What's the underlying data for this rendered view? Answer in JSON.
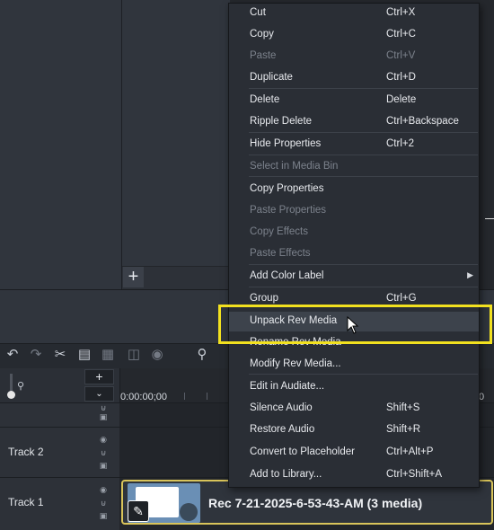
{
  "menu": {
    "items": [
      {
        "label": "Cut",
        "shortcut": "Ctrl+X",
        "disabled": false
      },
      {
        "label": "Copy",
        "shortcut": "Ctrl+C",
        "disabled": false
      },
      {
        "label": "Paste",
        "shortcut": "Ctrl+V",
        "disabled": true
      },
      {
        "label": "Duplicate",
        "shortcut": "Ctrl+D",
        "disabled": false
      },
      {
        "label": "Delete",
        "shortcut": "Delete",
        "disabled": false
      },
      {
        "label": "Ripple Delete",
        "shortcut": "Ctrl+Backspace",
        "disabled": false
      },
      {
        "label": "Hide Properties",
        "shortcut": "Ctrl+2",
        "disabled": false
      },
      {
        "label": "Select in Media Bin",
        "shortcut": "",
        "disabled": true
      },
      {
        "label": "Copy Properties",
        "shortcut": "",
        "disabled": false
      },
      {
        "label": "Paste Properties",
        "shortcut": "",
        "disabled": true
      },
      {
        "label": "Copy Effects",
        "shortcut": "",
        "disabled": true
      },
      {
        "label": "Paste Effects",
        "shortcut": "",
        "disabled": true
      },
      {
        "label": "Add Color Label",
        "shortcut": "",
        "disabled": false,
        "submenu": true
      },
      {
        "label": "Group",
        "shortcut": "Ctrl+G",
        "disabled": false
      },
      {
        "label": "Unpack Rev Media",
        "shortcut": "",
        "disabled": false,
        "highlighted": true
      },
      {
        "label": "Rename Rev Media",
        "shortcut": "",
        "disabled": false
      },
      {
        "label": "Modify Rev Media...",
        "shortcut": "",
        "disabled": false
      },
      {
        "label": "Edit in Audiate...",
        "shortcut": "",
        "disabled": false
      },
      {
        "label": "Silence Audio",
        "shortcut": "Shift+S",
        "disabled": false
      },
      {
        "label": "Restore Audio",
        "shortcut": "Shift+R",
        "disabled": false
      },
      {
        "label": "Convert to Placeholder",
        "shortcut": "Ctrl+Alt+P",
        "disabled": false
      },
      {
        "label": "Add to Library...",
        "shortcut": "Ctrl+Shift+A",
        "disabled": false
      }
    ]
  },
  "timeline": {
    "timecode_start": "0:00:00;00",
    "timecode_right": "0",
    "tracks": [
      {
        "label": ""
      },
      {
        "label": "Track 2"
      },
      {
        "label": "Track 1"
      }
    ],
    "clip": {
      "title": "Rec 7-21-2025-6-53-43-AM  (3 media)"
    }
  },
  "icons": {
    "add_media": "plus-icon",
    "edit": "pencil-icon"
  },
  "colors": {
    "highlight_box": "#f2e11f",
    "clip_border": "#d9c45a"
  }
}
